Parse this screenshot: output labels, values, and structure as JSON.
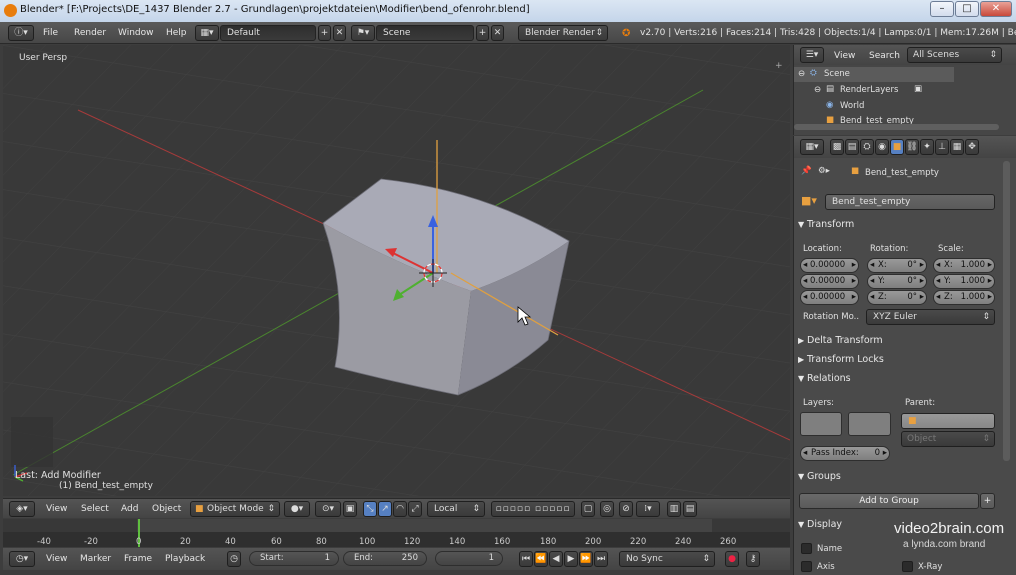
{
  "window": {
    "title": "Blender* [F:\\Projects\\DE_1437 Blender 2.7 - Grundlagen\\projektdateien\\Modifier\\bend_ofenrohr.blend]",
    "minimize": "–",
    "maximize": "□",
    "close": "✕"
  },
  "info_header": {
    "menus": [
      "File",
      "Render",
      "Window",
      "Help"
    ],
    "layout": "Default",
    "scene": "Scene",
    "engine": "Blender Render",
    "stats": "v2.70 | Verts:216 | Faces:214 | Tris:428 | Objects:1/4 | Lamps:0/1 | Mem:17.26M | Bend_test"
  },
  "viewport": {
    "view_name": "User Persp",
    "last_operator": "Last: Add Modifier",
    "object_label": "(1) Bend_test_empty"
  },
  "view3d_header": {
    "menus": [
      "View",
      "Select",
      "Add",
      "Object"
    ],
    "mode": "Object Mode",
    "orientation": "Local"
  },
  "timeline": {
    "ticks": [
      "-40",
      "-20",
      "0",
      "20",
      "40",
      "60",
      "80",
      "100",
      "120",
      "140",
      "160",
      "180",
      "200",
      "220",
      "240",
      "260"
    ],
    "current_frame_tick": "0"
  },
  "timeline_header": {
    "menus": [
      "View",
      "Marker",
      "Frame",
      "Playback"
    ],
    "start_label": "Start:",
    "start_value": "1",
    "end_label": "End:",
    "end_value": "250",
    "current_frame": "1",
    "sync": "No Sync"
  },
  "outliner": {
    "view": "View",
    "search": "Search",
    "filter": "All Scenes",
    "items": [
      "Scene",
      "RenderLayers",
      "World",
      "Bend_test_empty"
    ]
  },
  "properties": {
    "breadcrumb": "Bend_test_empty",
    "object_name": "Bend_test_empty",
    "transform": {
      "title": "Transform",
      "location_label": "Location:",
      "rotation_label": "Rotation:",
      "scale_label": "Scale:",
      "location": [
        "0.00000",
        "0.00000",
        "0.00000"
      ],
      "rotation": [
        {
          "axis": "X:",
          "value": "0°"
        },
        {
          "axis": "Y:",
          "value": "0°"
        },
        {
          "axis": "Z:",
          "value": "0°"
        }
      ],
      "scale": [
        {
          "axis": "X:",
          "value": "1.000"
        },
        {
          "axis": "Y:",
          "value": "1.000"
        },
        {
          "axis": "Z:",
          "value": "1.000"
        }
      ],
      "rotation_mode_label": "Rotation Mo..",
      "rotation_mode": "XYZ Euler"
    },
    "panels": {
      "delta": "Delta Transform",
      "locks": "Transform Locks",
      "relations": "Relations",
      "groups": "Groups",
      "display": "Display"
    },
    "relations": {
      "layers_label": "Layers:",
      "parent_label": "Parent:",
      "parent_type": "Object",
      "pass_index_label": "Pass Index:",
      "pass_index": "0"
    },
    "groups": {
      "add_button": "Add to Group"
    },
    "display": {
      "name": "Name",
      "axis": "Axis",
      "xray": "X-Ray"
    }
  },
  "watermark": {
    "line1": "video2brain.com",
    "line2": "a lynda.com brand"
  },
  "colors": {
    "accent_orange": "#e87d0d",
    "x_axis": "#c23b3b",
    "y_axis": "#5d9e33",
    "z_axis": "#3a62e0"
  }
}
